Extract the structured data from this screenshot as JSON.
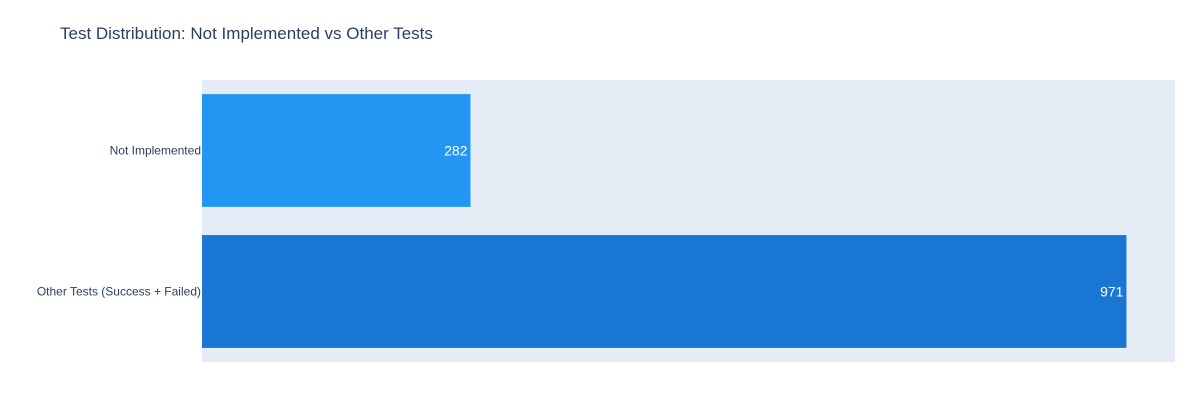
{
  "chart_data": {
    "type": "bar",
    "orientation": "horizontal",
    "title": "Test Distribution: Not Implemented vs Other Tests",
    "categories": [
      "Not Implemented",
      "Other Tests (Success + Failed)"
    ],
    "values": [
      282,
      971
    ],
    "colors": [
      "#2196f3",
      "#1976d2"
    ],
    "plot_background": "#e5ecf6",
    "xlim": [
      0,
      1022
    ],
    "grid": false,
    "xlabel": "",
    "ylabel": ""
  }
}
